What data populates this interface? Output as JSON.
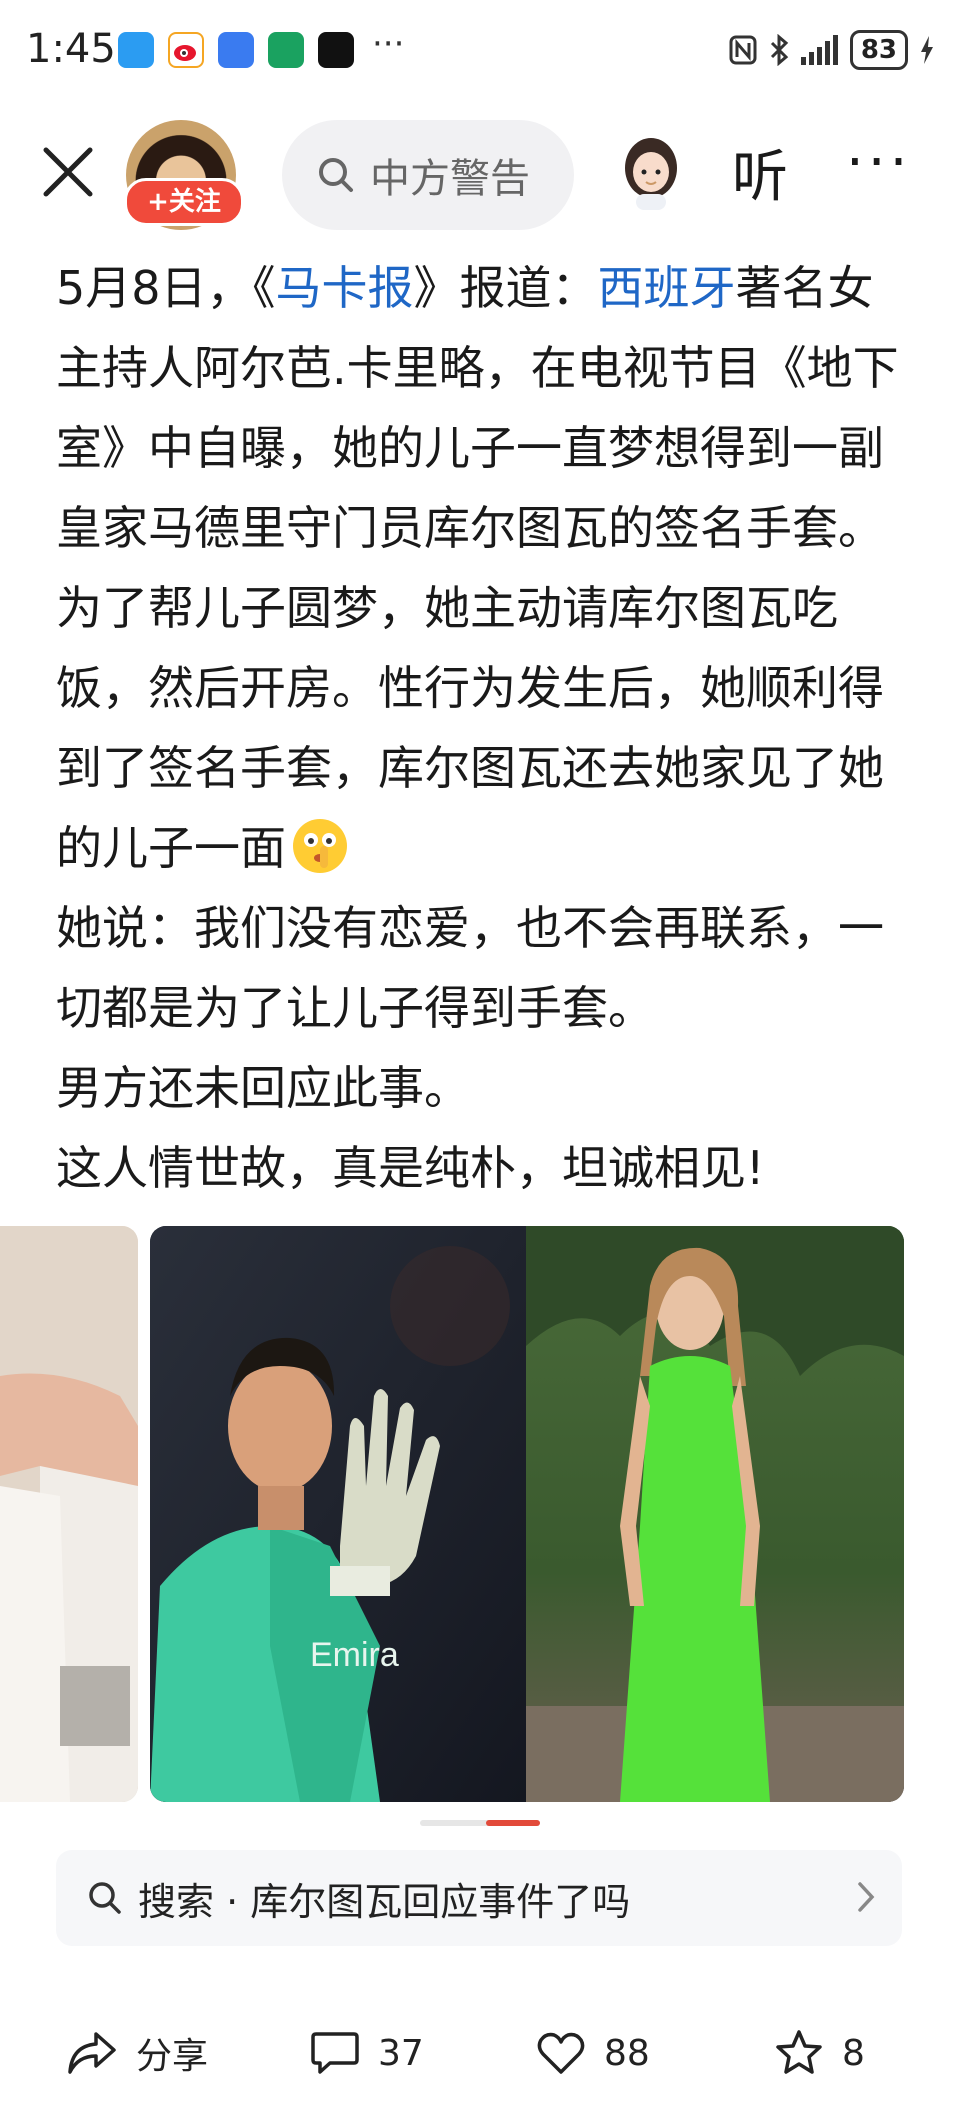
{
  "status_bar": {
    "time": "1:45",
    "more": "···",
    "battery": "83"
  },
  "header": {
    "follow_label": "+关注",
    "search_placeholder": "中方警告",
    "listen_label": "听",
    "more_label": "···"
  },
  "post": {
    "paragraphs": [
      {
        "before": "5月8日，《",
        "link1": "马卡报",
        "middle": "》报道：",
        "link2": "西班牙",
        "after": "著名女主持人阿尔芭.卡里略，在电视节目《地下室》中自曝，她的儿子一直梦想得到一副皇家马德里守门员库尔图瓦的签名手套。"
      },
      {
        "text": "为了帮儿子圆梦，她主动请库尔图瓦吃饭，然后开房。性行为发生后，她顺利得到了签名手套，库尔图瓦还去她家见了她的儿子一面"
      },
      {
        "text": "她说：我们没有恋爱，也不会再联系，一切都是为了让儿子得到手套。"
      },
      {
        "text": "男方还未回应此事。"
      },
      {
        "text": "这人情世故，真是纯朴，坦诚相见!"
      }
    ],
    "emoji": "shush-face-icon"
  },
  "images": {
    "jersey_text": "Emira"
  },
  "suggestion": {
    "label": "搜索 · 库尔图瓦回应事件了吗"
  },
  "actions": {
    "share_label": "分享",
    "comments": "37",
    "likes": "88",
    "favorites": "8"
  },
  "colors": {
    "link": "#1f67c6",
    "accent_red": "#e24a3a",
    "follow_red": "#f04a3b"
  }
}
